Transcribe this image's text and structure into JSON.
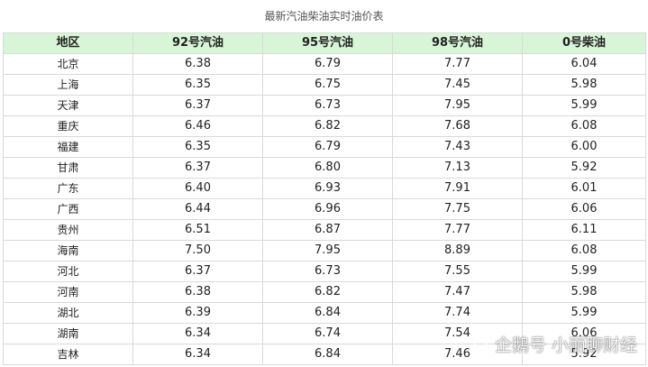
{
  "caption": "最新汽油柴油实时油价表",
  "table": {
    "headers": [
      "地区",
      "92号汽油",
      "95号汽油",
      "98号汽油",
      "0号柴油"
    ],
    "rows": [
      [
        "北京",
        "6.38",
        "6.79",
        "7.77",
        "6.04"
      ],
      [
        "上海",
        "6.35",
        "6.75",
        "7.45",
        "5.98"
      ],
      [
        "天津",
        "6.37",
        "6.73",
        "7.95",
        "5.99"
      ],
      [
        "重庆",
        "6.46",
        "6.82",
        "7.68",
        "6.08"
      ],
      [
        "福建",
        "6.35",
        "6.79",
        "7.43",
        "6.00"
      ],
      [
        "甘肃",
        "6.37",
        "6.80",
        "7.13",
        "5.92"
      ],
      [
        "广东",
        "6.40",
        "6.93",
        "7.91",
        "6.01"
      ],
      [
        "广西",
        "6.44",
        "6.96",
        "7.75",
        "6.06"
      ],
      [
        "贵州",
        "6.51",
        "6.87",
        "7.77",
        "6.11"
      ],
      [
        "海南",
        "7.50",
        "7.95",
        "8.89",
        "6.08"
      ],
      [
        "河北",
        "6.37",
        "6.73",
        "7.55",
        "5.99"
      ],
      [
        "河南",
        "6.38",
        "6.82",
        "7.47",
        "5.98"
      ],
      [
        "湖北",
        "6.39",
        "6.84",
        "7.74",
        "5.99"
      ],
      [
        "湖南",
        "6.34",
        "6.74",
        "7.54",
        "6.06"
      ],
      [
        "吉林",
        "6.34",
        "6.84",
        "7.46",
        "5.92"
      ]
    ]
  },
  "watermark": {
    "text": "企鹅号 小丽聊财经",
    "icon": "penguin-logo-icon"
  }
}
